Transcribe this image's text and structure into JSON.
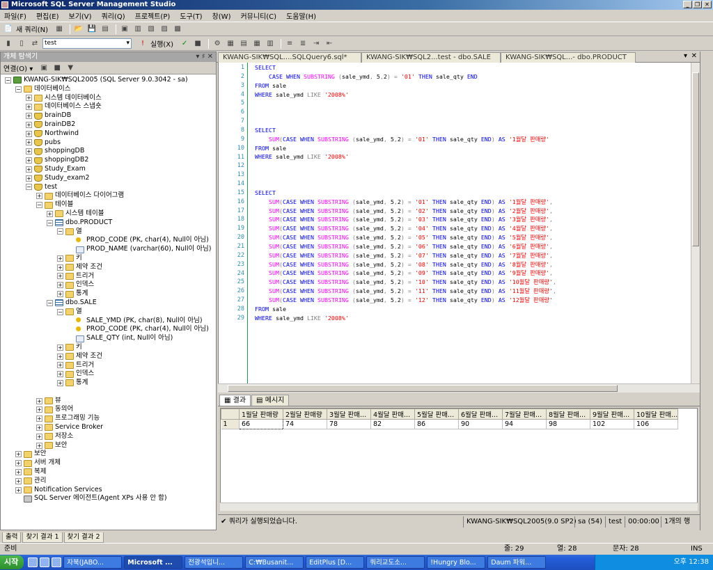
{
  "app": {
    "title": "Microsoft SQL Server Management Studio"
  },
  "menu": [
    "파일(F)",
    "편집(E)",
    "보기(V)",
    "쿼리(Q)",
    "프로젝트(P)",
    "도구(T)",
    "창(W)",
    "커뮤니티(C)",
    "도움말(H)"
  ],
  "toolbar1": {
    "new_query": "새 쿼리(N)"
  },
  "toolbar2": {
    "db": "test",
    "execute": "실행(X)"
  },
  "object_explorer": {
    "title": "개체 탐색기",
    "connect": "연결(O) ▾",
    "tree": [
      {
        "t": "KWANG-SIK₩SQL2005 (SQL Server 9.0.3042 - sa)",
        "lv": 0,
        "e": "−",
        "i": "server"
      },
      {
        "t": "데이터베이스",
        "lv": 1,
        "e": "−",
        "i": "folder"
      },
      {
        "t": "시스템 데이터베이스",
        "lv": 2,
        "e": "+",
        "i": "folder"
      },
      {
        "t": "데이터베이스 스냅숏",
        "lv": 2,
        "e": "+",
        "i": "folder"
      },
      {
        "t": "brainDB",
        "lv": 2,
        "e": "+",
        "i": "db"
      },
      {
        "t": "brainDB2",
        "lv": 2,
        "e": "+",
        "i": "db"
      },
      {
        "t": "Northwind",
        "lv": 2,
        "e": "+",
        "i": "db"
      },
      {
        "t": "pubs",
        "lv": 2,
        "e": "+",
        "i": "db"
      },
      {
        "t": "shoppingDB",
        "lv": 2,
        "e": "+",
        "i": "db"
      },
      {
        "t": "shoppingDB2",
        "lv": 2,
        "e": "+",
        "i": "db"
      },
      {
        "t": "Study_Exam",
        "lv": 2,
        "e": "+",
        "i": "db"
      },
      {
        "t": "Study_exam2",
        "lv": 2,
        "e": "+",
        "i": "db"
      },
      {
        "t": "test",
        "lv": 2,
        "e": "−",
        "i": "db"
      },
      {
        "t": "데이터베이스 다이어그램",
        "lv": 3,
        "e": "+",
        "i": "folder"
      },
      {
        "t": "테이블",
        "lv": 3,
        "e": "−",
        "i": "folder"
      },
      {
        "t": "시스템 테이블",
        "lv": 4,
        "e": "+",
        "i": "folder"
      },
      {
        "t": "dbo.PRODUCT",
        "lv": 4,
        "e": "−",
        "i": "table"
      },
      {
        "t": "열",
        "lv": 5,
        "e": "−",
        "i": "folder"
      },
      {
        "t": "PROD_CODE (PK, char(4), Null이 아님)",
        "lv": 6,
        "e": "",
        "i": "key"
      },
      {
        "t": "PROD_NAME (varchar(60), Null이 아님)",
        "lv": 6,
        "e": "",
        "i": "col"
      },
      {
        "t": "키",
        "lv": 5,
        "e": "+",
        "i": "folder"
      },
      {
        "t": "제약 조건",
        "lv": 5,
        "e": "+",
        "i": "folder"
      },
      {
        "t": "트리거",
        "lv": 5,
        "e": "+",
        "i": "folder"
      },
      {
        "t": "인덱스",
        "lv": 5,
        "e": "+",
        "i": "folder"
      },
      {
        "t": "통계",
        "lv": 5,
        "e": "+",
        "i": "folder"
      },
      {
        "t": "dbo.SALE",
        "lv": 4,
        "e": "−",
        "i": "table"
      },
      {
        "t": "열",
        "lv": 5,
        "e": "−",
        "i": "folder"
      },
      {
        "t": "SALE_YMD (PK, char(8), Null이 아님)",
        "lv": 6,
        "e": "",
        "i": "key"
      },
      {
        "t": "PROD_CODE (PK, char(4), Null이 아님)",
        "lv": 6,
        "e": "",
        "i": "key"
      },
      {
        "t": "SALE_QTY (int, Null이 아님)",
        "lv": 6,
        "e": "",
        "i": "col"
      },
      {
        "t": "키",
        "lv": 5,
        "e": "+",
        "i": "folder"
      },
      {
        "t": "제약 조건",
        "lv": 5,
        "e": "+",
        "i": "folder"
      },
      {
        "t": "트리거",
        "lv": 5,
        "e": "+",
        "i": "folder"
      },
      {
        "t": "인덱스",
        "lv": 5,
        "e": "+",
        "i": "folder"
      },
      {
        "t": "통계",
        "lv": 5,
        "e": "+",
        "i": "folder"
      },
      {
        "t": "",
        "lv": 3,
        "e": "",
        "i": ""
      },
      {
        "t": "뷰",
        "lv": 3,
        "e": "+",
        "i": "folder"
      },
      {
        "t": "동의어",
        "lv": 3,
        "e": "+",
        "i": "folder"
      },
      {
        "t": "프로그래밍 기능",
        "lv": 3,
        "e": "+",
        "i": "folder"
      },
      {
        "t": "Service Broker",
        "lv": 3,
        "e": "+",
        "i": "folder"
      },
      {
        "t": "저장소",
        "lv": 3,
        "e": "+",
        "i": "folder"
      },
      {
        "t": "보안",
        "lv": 3,
        "e": "+",
        "i": "folder"
      },
      {
        "t": "보안",
        "lv": 1,
        "e": "+",
        "i": "folder"
      },
      {
        "t": "서버 개체",
        "lv": 1,
        "e": "+",
        "i": "folder"
      },
      {
        "t": "복제",
        "lv": 1,
        "e": "+",
        "i": "folder"
      },
      {
        "t": "관리",
        "lv": 1,
        "e": "+",
        "i": "folder"
      },
      {
        "t": "Notification Services",
        "lv": 1,
        "e": "+",
        "i": "folder"
      },
      {
        "t": "SQL Server 에이전트(Agent XPs 사용 안 함)",
        "lv": 1,
        "e": "",
        "i": "agent"
      }
    ]
  },
  "tabs": [
    {
      "label": "KWANG-SIK₩SQL....SQLQuery6.sql*",
      "active": true
    },
    {
      "label": "KWANG-SIK₩SQL2...test - dbo.SALE",
      "active": false
    },
    {
      "label": "KWANG-SIK₩SQL...- dbo.PRODUCT",
      "active": false
    }
  ],
  "code": [
    "<span class=kw>SELECT</span>",
    "    <span class=kw>CASE WHEN</span> <span class=fn>SUBSTRING</span> <span class=op>(</span>sale_ymd<span class=op>,</span> 5<span class=op>,</span>2<span class=op>)</span> <span class=op>=</span> <span class=str>'01'</span> <span class=kw>THEN</span> sale_qty <span class=kw>END</span>",
    "<span class=kw>FROM</span> sale",
    "<span class=kw>WHERE</span> sale_ymd <span class=op>LIKE</span> <span class=str>'2008%'</span>",
    "",
    "",
    "",
    "<span class=kw>SELECT</span>",
    "    <span class=fn>SUM</span><span class=op>(</span><span class=kw>CASE WHEN</span> <span class=fn>SUBSTRING</span> <span class=op>(</span>sale_ymd<span class=op>,</span> 5<span class=op>,</span>2<span class=op>)</span> <span class=op>=</span> <span class=str>'01'</span> <span class=kw>THEN</span> sale_qty <span class=kw>END</span><span class=op>)</span> <span class=kw>AS</span> <span class=str>'1월달 판매량'</span>",
    "<span class=kw>FROM</span> sale",
    "<span class=kw>WHERE</span> sale_ymd <span class=op>LIKE</span> <span class=str>'2008%'</span>",
    "",
    "",
    "",
    "<span class=kw>SELECT</span>"
  ],
  "months": [
    "01",
    "02",
    "03",
    "04",
    "05",
    "06",
    "07",
    "08",
    "09",
    "10",
    "11",
    "12"
  ],
  "tail": [
    "<span class=kw>FROM</span> sale",
    "<span class=kw>WHERE</span> sale_ymd <span class=op>LIKE</span> <span class=str>'2008%'</span>"
  ],
  "result_tabs": [
    "결과",
    "메시지"
  ],
  "results": {
    "headers": [
      "1월달 판매량",
      "2월달 판매량",
      "3월달 판매...",
      "4월달 판매...",
      "5월달 판매...",
      "6월달 판매...",
      "7월달 판매...",
      "8월달 판매...",
      "9월달 판매...",
      "10월달 판매..."
    ],
    "row_num": "1",
    "values": [
      "66",
      "74",
      "78",
      "82",
      "86",
      "90",
      "94",
      "98",
      "102",
      "106"
    ]
  },
  "query_status": {
    "msg": "쿼리가 실행되었습니다.",
    "server": "KWANG-SIK₩SQL2005(9.0 SP2)",
    "user": "sa (54)",
    "db": "test",
    "time": "00:00:00",
    "rows": "1개의 행"
  },
  "bottom_tabs": [
    "출력",
    "찾기 결과 1",
    "찾기 결과 2"
  ],
  "status": {
    "ready": "준비",
    "line": "줄: 29",
    "col": "열: 28",
    "ch": "문자: 28",
    "ins": "INS"
  },
  "taskbar": {
    "start": "시작",
    "tasks": [
      "자북(JABO...",
      "Microsoft ...",
      "전광석입니...",
      "C:₩Busanit...",
      "EditPlus [D...",
      "쿼리교도소...",
      "!Hungry Blo...",
      "Daum 파워..."
    ],
    "clock": "오후 12:38"
  }
}
